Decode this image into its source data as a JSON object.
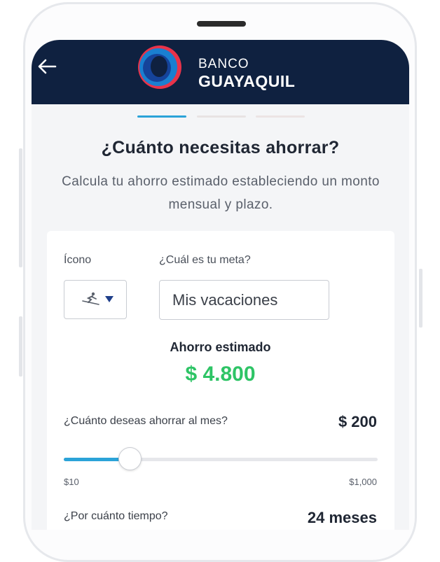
{
  "header": {
    "back_icon": "arrow-left-icon",
    "brand_line1": "BANCO",
    "brand_line2": "GUAYAQUIL",
    "colors": {
      "bar": "#0f2140",
      "logo_red": "#e8334a",
      "logo_blue": "#1a7fd0"
    }
  },
  "progress": {
    "steps": 3,
    "active_step": 1,
    "active_color": "#2ba3d8"
  },
  "page": {
    "title": "¿Cuánto necesitas ahorrar?",
    "subtitle": "Calcula tu ahorro estimado estableciendo un monto mensual y plazo."
  },
  "form": {
    "icon_label": "Ícono",
    "icon_selected": "skier-icon",
    "dropdown_icon": "caret-down-icon",
    "goal_label": "¿Cuál es tu meta?",
    "goal_value": "Mis vacaciones"
  },
  "estimate": {
    "label": "Ahorro estimado",
    "value": "$ 4.800",
    "color": "#2ec466"
  },
  "monthly": {
    "question": "¿Cuánto deseas ahorrar al mes?",
    "value": "$ 200",
    "slider_min_label": "$10",
    "slider_max_label": "$1,000",
    "slider_level": 0.21
  },
  "term": {
    "question": "¿Por cuánto tiempo?",
    "value": "24 meses"
  }
}
